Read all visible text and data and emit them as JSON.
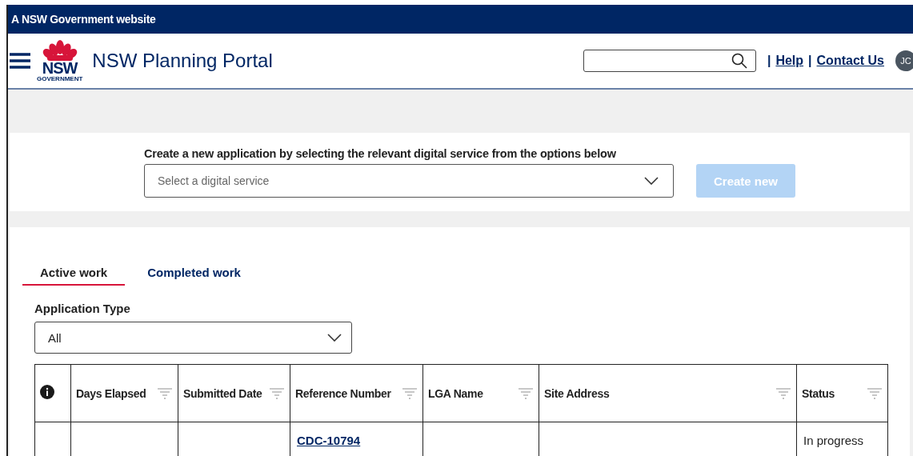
{
  "gov_banner": "A NSW Government website",
  "header": {
    "logo": {
      "mark": "NSW",
      "sub": "GOVERNMENT"
    },
    "title": "NSW Planning Portal",
    "links": [
      {
        "separator": "|",
        "label": "Help"
      },
      {
        "separator": "|",
        "label": "Contact Us"
      }
    ],
    "avatar": "JC"
  },
  "create": {
    "prompt": "Create a new application by selecting the relevant digital service from the options below",
    "select": {
      "placeholder": "Select a digital service"
    },
    "button": {
      "label": "Create new",
      "disabled": true
    }
  },
  "tabs": [
    {
      "label": "Active work",
      "selected": true
    },
    {
      "label": "Completed work",
      "selected": false
    }
  ],
  "filter": {
    "label": "Application Type",
    "value": "All"
  },
  "table": {
    "columns": [
      {
        "kind": "info"
      },
      {
        "kind": "text",
        "label": "Days Elapsed"
      },
      {
        "kind": "text",
        "label": "Submitted Date"
      },
      {
        "kind": "text",
        "label": "Reference Number"
      },
      {
        "kind": "text",
        "label": "LGA Name"
      },
      {
        "kind": "text",
        "label": "Site Address"
      },
      {
        "kind": "text",
        "label": "Status"
      }
    ],
    "rows": [
      {
        "cells": [
          {
            "kind": "empty"
          },
          {
            "kind": "empty"
          },
          {
            "kind": "empty"
          },
          {
            "kind": "link",
            "text": "CDC-10794"
          },
          {
            "kind": "empty"
          },
          {
            "kind": "empty"
          },
          {
            "kind": "text",
            "text": "In progress"
          }
        ]
      }
    ]
  }
}
